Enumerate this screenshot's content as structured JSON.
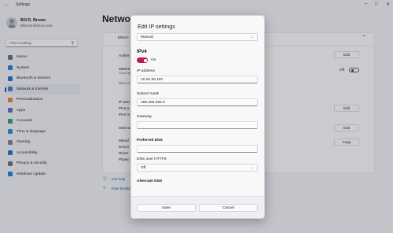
{
  "window": {
    "title": "Settings"
  },
  "profile": {
    "name": "Bill D. Brown",
    "email": "billbrown@locus.local"
  },
  "search": {
    "placeholder": "Find a setting"
  },
  "sidebar": {
    "items": [
      {
        "label": "Home",
        "icon": "home-icon",
        "color": "#6b6f78"
      },
      {
        "label": "System",
        "icon": "system-icon",
        "color": "#1f7fd0"
      },
      {
        "label": "Bluetooth & devices",
        "icon": "bluetooth-icon",
        "color": "#1f6fd0"
      },
      {
        "label": "Network & internet",
        "icon": "network-icon",
        "color": "#3a7bd5",
        "active": true
      },
      {
        "label": "Personalization",
        "icon": "brush-icon",
        "color": "#d98a2b"
      },
      {
        "label": "Apps",
        "icon": "apps-icon",
        "color": "#5a6fb8"
      },
      {
        "label": "Accounts",
        "icon": "accounts-icon",
        "color": "#2c9c5c"
      },
      {
        "label": "Time & language",
        "icon": "clock-icon",
        "color": "#2b8ad1"
      },
      {
        "label": "Gaming",
        "icon": "gaming-icon",
        "color": "#7a7f88"
      },
      {
        "label": "Accessibility",
        "icon": "accessibility-icon",
        "color": "#2a6cc8"
      },
      {
        "label": "Privacy & security",
        "icon": "shield-icon",
        "color": "#6b6f78"
      },
      {
        "label": "Windows Update",
        "icon": "update-icon",
        "color": "#1f7fd0"
      }
    ]
  },
  "page": {
    "title": "Networ"
  },
  "background": {
    "card_title": "Ethern",
    "auth_label": "Auther",
    "metered_label": "Metere",
    "metered_sub": "Some ap",
    "set_link": "Set a c",
    "ip_assign": "IP assi",
    "ipv4_a": "IPv4 a",
    "ipv4_m": "IPv4 m",
    "dns_s": "DNS se",
    "manual": "Manuf",
    "desc": "Descri",
    "driver": "Driver",
    "physical": "Physic",
    "edit": "Edit",
    "copy": "Copy",
    "off_label": "Off",
    "get_help": "Get help",
    "give_feedback": "Give feedba"
  },
  "dialog": {
    "title": "Edit IP settings",
    "mode": "Manual",
    "ipv4_heading": "IPv4",
    "ipv4_toggle": "On",
    "ip_label": "IP address",
    "ip_value": "10.20.30.100",
    "mask_label": "Subnet mask",
    "mask_value": "255.255.255.0",
    "gateway_label": "Gateway",
    "gateway_value": "",
    "pref_dns_label": "Preferred DNS",
    "pref_dns_value": "",
    "doh_label": "DNS over HTTPS",
    "doh_value": "Off",
    "alt_dns_label": "Alternate DNS",
    "save": "Save",
    "cancel": "Cancel",
    "accent": "#b81d4f"
  }
}
